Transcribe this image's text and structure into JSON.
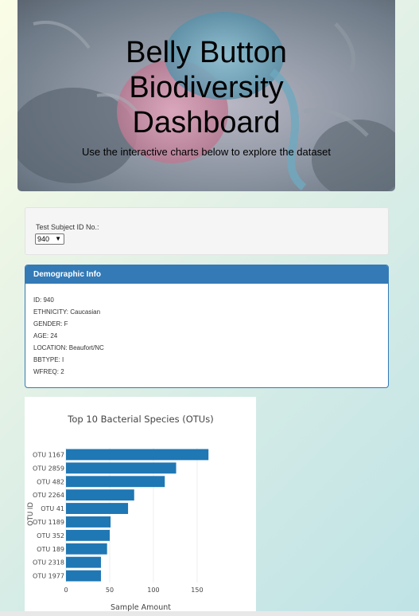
{
  "header": {
    "title_lines": [
      "Belly Button",
      "Biodiversity",
      "Dashboard"
    ],
    "subtitle": "Use the interactive charts below to explore the dataset"
  },
  "selector": {
    "label": "Test Subject ID No.:",
    "selected": "940"
  },
  "demographics": {
    "heading": "Demographic Info",
    "rows": [
      "ID: 940",
      "ETHNICITY: Caucasian",
      "GENDER: F",
      "AGE: 24",
      "LOCATION: Beaufort/NC",
      "BBTYPE: I",
      "WFREQ: 2"
    ]
  },
  "chart_data": {
    "type": "bar",
    "orientation": "horizontal",
    "title": "Top 10 Bacterial Species (OTUs)",
    "xlabel": "Sample Amount",
    "ylabel": "OTU ID",
    "categories": [
      "OTU 1167",
      "OTU 2859",
      "OTU 482",
      "OTU 2264",
      "OTU 41",
      "OTU 1189",
      "OTU 352",
      "OTU 189",
      "OTU 2318",
      "OTU 1977"
    ],
    "values": [
      163,
      126,
      113,
      78,
      71,
      51,
      50,
      47,
      40,
      40
    ],
    "xticks": [
      0,
      50,
      100,
      150
    ],
    "xlim": [
      0,
      171
    ],
    "grid": true,
    "bar_color": "#1f77b4"
  }
}
